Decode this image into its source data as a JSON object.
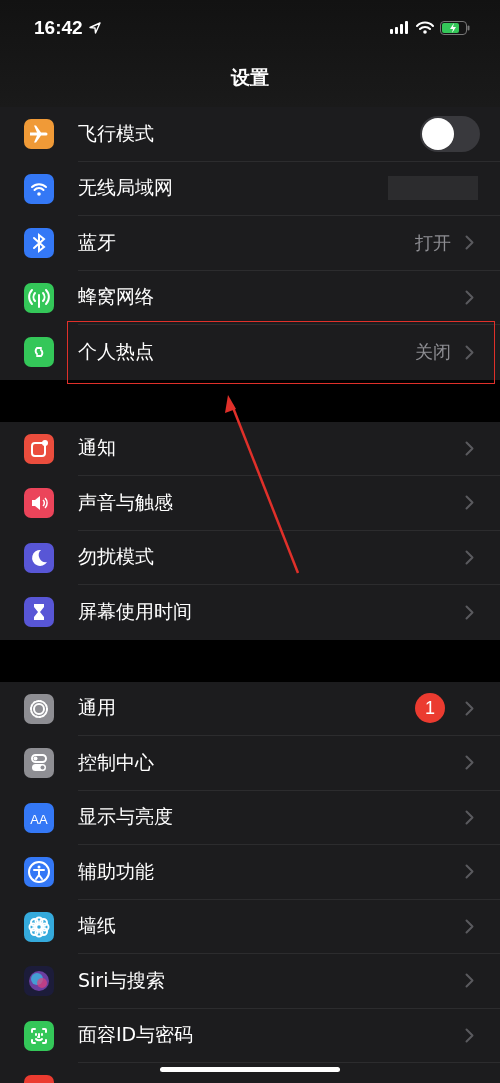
{
  "status_bar": {
    "time": "16:42"
  },
  "nav": {
    "title": "设置"
  },
  "groups": [
    {
      "rows": [
        {
          "kind": "toggle",
          "label": "飞行模式",
          "on": false
        },
        {
          "kind": "redacted",
          "label": "无线局域网"
        },
        {
          "kind": "link",
          "label": "蓝牙",
          "value": "打开"
        },
        {
          "kind": "link",
          "label": "蜂窝网络"
        },
        {
          "kind": "link",
          "label": "个人热点",
          "value": "关闭",
          "highlighted": true
        }
      ]
    },
    {
      "rows": [
        {
          "kind": "link",
          "label": "通知"
        },
        {
          "kind": "link",
          "label": "声音与触感"
        },
        {
          "kind": "link",
          "label": "勿扰模式"
        },
        {
          "kind": "link",
          "label": "屏幕使用时间"
        }
      ]
    },
    {
      "rows": [
        {
          "kind": "badge",
          "label": "通用",
          "badge": "1"
        },
        {
          "kind": "link",
          "label": "控制中心"
        },
        {
          "kind": "link",
          "icon_text": "AA",
          "label": "显示与亮度"
        },
        {
          "kind": "link",
          "label": "辅助功能"
        },
        {
          "kind": "link",
          "label": "墙纸"
        },
        {
          "kind": "link",
          "label": "Siri与搜索"
        },
        {
          "kind": "link",
          "label": "面容ID与密码"
        },
        {
          "kind": "cut"
        }
      ]
    }
  ]
}
